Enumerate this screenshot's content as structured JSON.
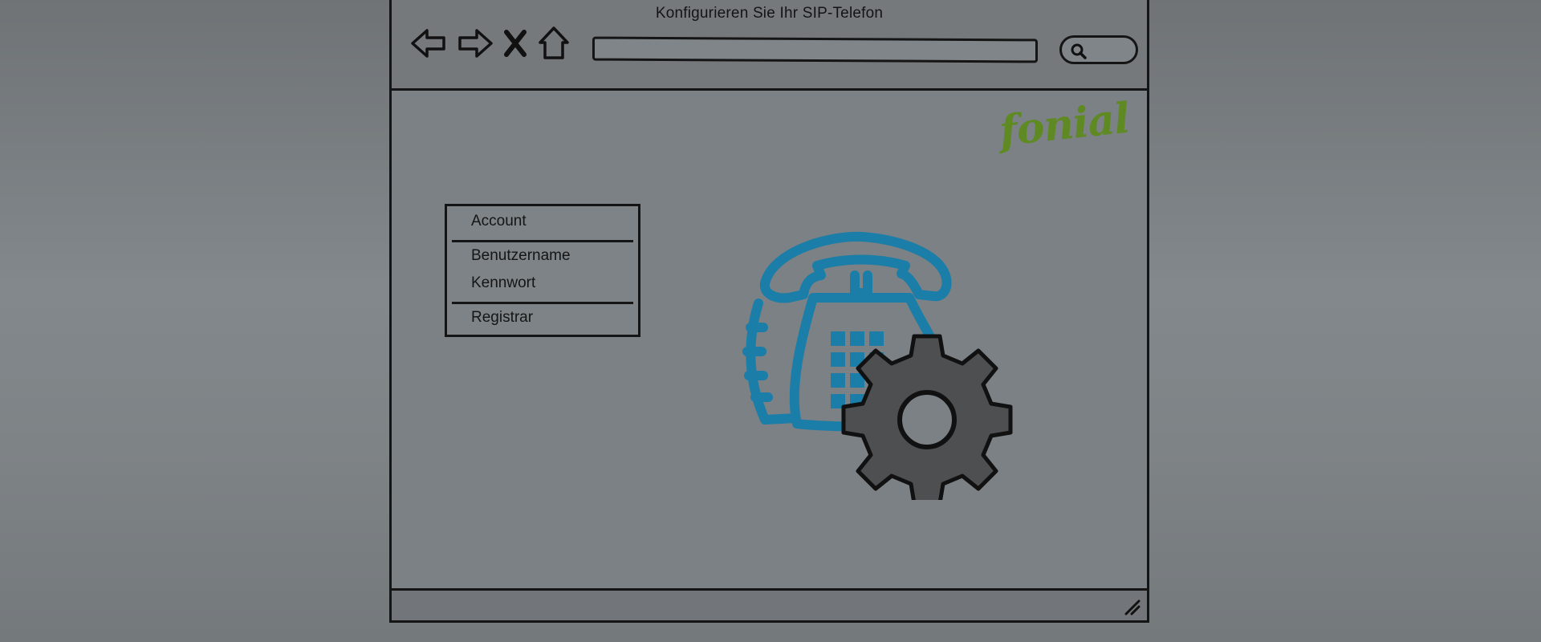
{
  "window": {
    "title": "Konfigurieren Sie Ihr SIP-Telefon"
  },
  "toolbar": {
    "icons": [
      "back-arrow-icon",
      "forward-arrow-icon",
      "close-x-icon",
      "home-icon"
    ],
    "url_value": "",
    "search_icon": "search-icon"
  },
  "brand": {
    "logo_text": "fonial",
    "color": "#5f8a23"
  },
  "menu": {
    "items": [
      {
        "label": "Account"
      },
      {
        "label": "Benutzername"
      },
      {
        "label": "Kennwort"
      },
      {
        "label": "Registrar"
      }
    ]
  },
  "illustration": {
    "phone_color": "#1a7ea8",
    "gear_color": "#4d4f51"
  }
}
